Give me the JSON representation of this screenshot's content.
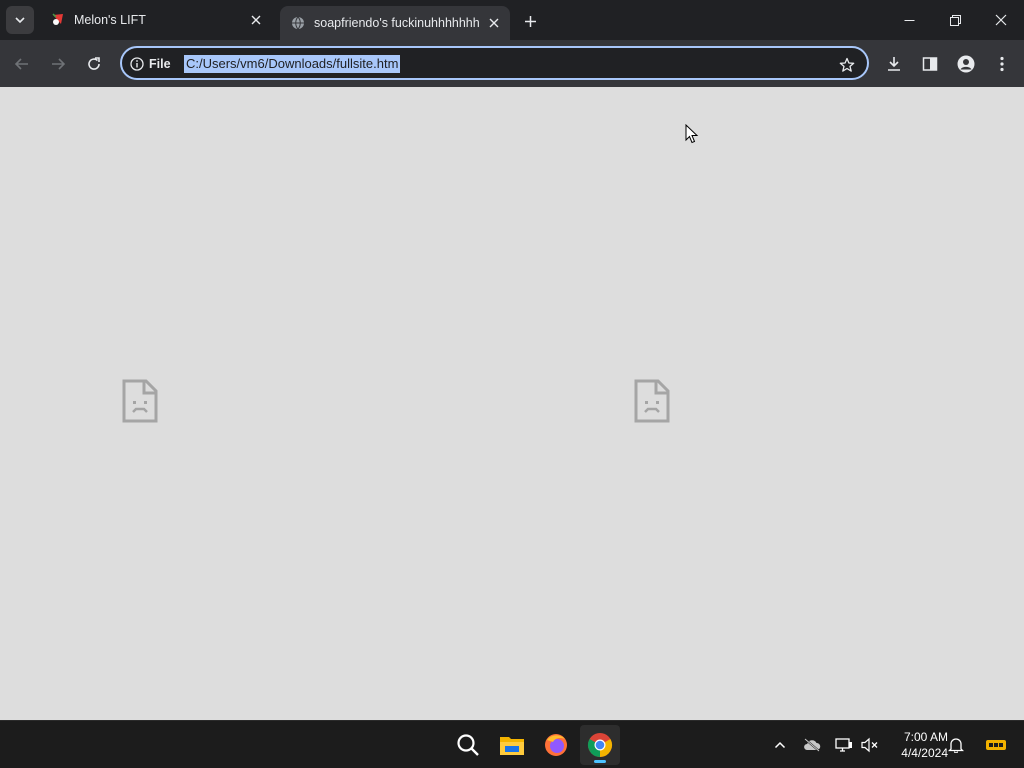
{
  "browser": {
    "tabs": [
      {
        "title": "Melon's LIFT",
        "active": false
      },
      {
        "title": "soapfriendo's fuckinuhhhhhhh",
        "active": true
      }
    ],
    "omnibox": {
      "chip_label": "File",
      "url": "C:/Users/vm6/Downloads/fullsite.htm"
    }
  },
  "content": {
    "broken_images": [
      "broken-image-icon",
      "broken-image-icon"
    ]
  },
  "taskbar": {
    "apps": [
      "search-icon",
      "file-explorer-icon",
      "firefox-icon",
      "chrome-icon"
    ],
    "active_app": "chrome-icon",
    "tray_icons": [
      "chevron-up-icon",
      "cloud-offline-icon",
      "network-icon",
      "volume-muted-icon",
      "notification-bell-icon",
      "pre-badge-icon"
    ],
    "time": "7:00 AM",
    "date": "4/4/2024"
  },
  "colors": {
    "accent": "#a8c7fa",
    "tabstrip": "#202124",
    "toolbar": "#35363a",
    "page_bg": "#dddddd",
    "taskbar_bg": "#1c1c1c"
  }
}
